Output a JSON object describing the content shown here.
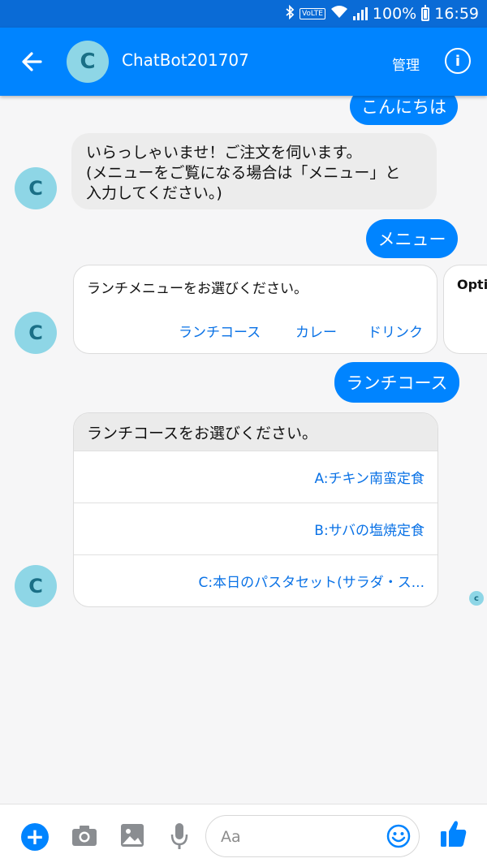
{
  "status_bar": {
    "volte": "VoLTE",
    "battery": "100%",
    "time": "16:59"
  },
  "header": {
    "title": "ChatBot201707",
    "avatar_letter": "C",
    "manage_label": "管理",
    "info_symbol": "i"
  },
  "messages": {
    "out_hello": "こんにちは",
    "in_welcome_line1": "いらっしゃいませ！ご注文を伺います。",
    "in_welcome_line2": "(メニューをご覧になる場合は「メニュー」と",
    "in_welcome_line3": "入力してください。)",
    "out_menu": "メニュー",
    "card_lunch": {
      "text": "ランチメニューをお選びください。",
      "buttons": [
        "ランチコース",
        "カレー",
        "ドリンク"
      ]
    },
    "card_next_peek": "Optio",
    "out_lunch_course": "ランチコース",
    "list_card": {
      "title": "ランチコースをお選びください。",
      "options": [
        "A:チキン南蛮定食",
        "B:サバの塩焼定食",
        "C:本日のパスタセット(サラダ・ス..."
      ]
    },
    "seen_avatar_letter": "c"
  },
  "composer": {
    "placeholder": "Aa"
  },
  "colors": {
    "brand": "#0084ff",
    "status_bar": "#0a6bd6",
    "avatar_bg": "#8ed6e6",
    "link": "#0a72e6"
  },
  "icons": [
    "back-arrow-icon",
    "info-icon",
    "plus-icon",
    "camera-icon",
    "image-icon",
    "microphone-icon",
    "emoji-icon",
    "thumbs-up-icon",
    "bluetooth-icon",
    "wifi-icon",
    "signal-icon",
    "battery-icon"
  ]
}
